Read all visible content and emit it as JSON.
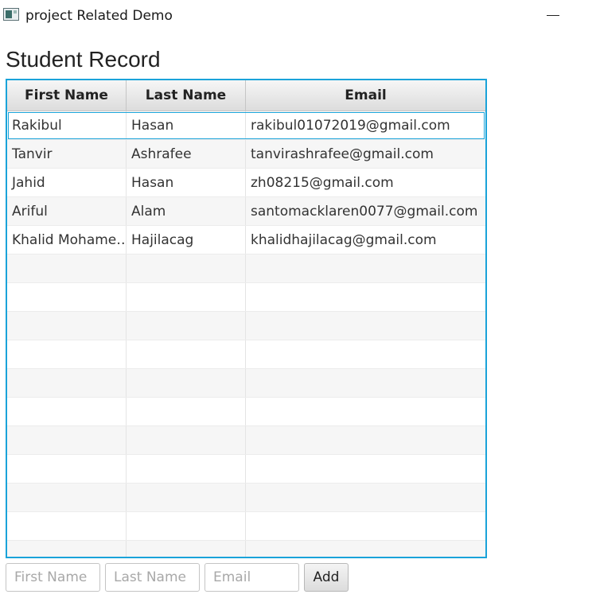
{
  "window": {
    "title": "project Related Demo"
  },
  "page": {
    "title": "Student Record"
  },
  "table": {
    "columns": [
      "First Name",
      "Last Name",
      "Email"
    ],
    "rows": [
      [
        "Rakibul",
        "Hasan",
        "rakibul01072019@gmail.com"
      ],
      [
        "Tanvir",
        "Ashrafee",
        "tanvirashrafee@gmail.com"
      ],
      [
        "Jahid",
        "Hasan",
        "zh08215@gmail.com"
      ],
      [
        "Ariful",
        "Alam",
        "santomacklaren0077@gmail.com"
      ],
      [
        "Khalid Mohame…",
        "Hajilacag",
        "khalidhajilacag@gmail.com"
      ]
    ],
    "selected_row": 0,
    "accent_color": "#1aa3d9"
  },
  "form": {
    "first_name": {
      "value": "",
      "placeholder": "First Name"
    },
    "last_name": {
      "value": "",
      "placeholder": "Last Name"
    },
    "email": {
      "value": "",
      "placeholder": "Email"
    },
    "add_label": "Add"
  }
}
